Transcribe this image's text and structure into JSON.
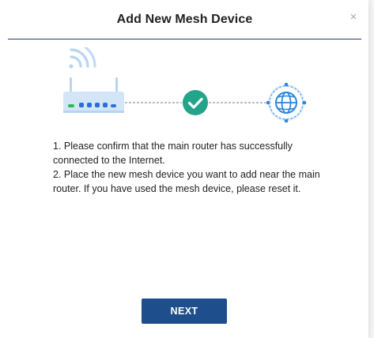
{
  "dialog": {
    "title": "Add New Mesh Device",
    "close_glyph": "×",
    "close_icon": "close-icon"
  },
  "diagram": {
    "icons": [
      "wifi-icon",
      "router-icon",
      "checkmark-circle-icon",
      "globe-icon"
    ],
    "status": "connected",
    "colors": {
      "router_body": "#d3e6f8",
      "router_accent": "#b7d5f2",
      "led_green": "#2fb94f",
      "led_blue": "#2b6fd6",
      "check_circle": "#23a48a",
      "globe": "#2b86e0",
      "globe_halo": "#d6e9fb",
      "link_line": "#6f7f96"
    }
  },
  "instructions": {
    "step1": "1. Please confirm that the main router has successfully connected to the Internet.",
    "step2": "2. Place the new mesh device you want to add near the main router. If you have used the mesh device, please reset it."
  },
  "actions": {
    "next_label": "NEXT",
    "next_color": "#1f4e8c"
  }
}
